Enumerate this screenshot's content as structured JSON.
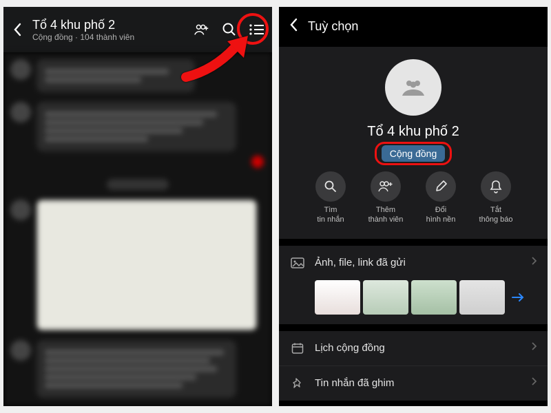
{
  "leftPhone": {
    "title": "Tổ 4 khu phố 2",
    "subtitle": "Cộng đồng · 104 thành viên"
  },
  "rightPhone": {
    "headerTitle": "Tuỳ chọn",
    "groupName": "Tổ 4 khu phố 2",
    "communityBadge": "Cộng đồng",
    "actions": {
      "search": "Tìm\ntin nhắn",
      "addMember": "Thêm\nthành viên",
      "changeBg": "Đổi\nhình nền",
      "muteNotif": "Tắt\nthông báo"
    },
    "rows": {
      "media": "Ảnh, file, link đã gửi",
      "calendar": "Lịch cộng đồng",
      "pinned": "Tin nhắn đã ghim"
    }
  }
}
